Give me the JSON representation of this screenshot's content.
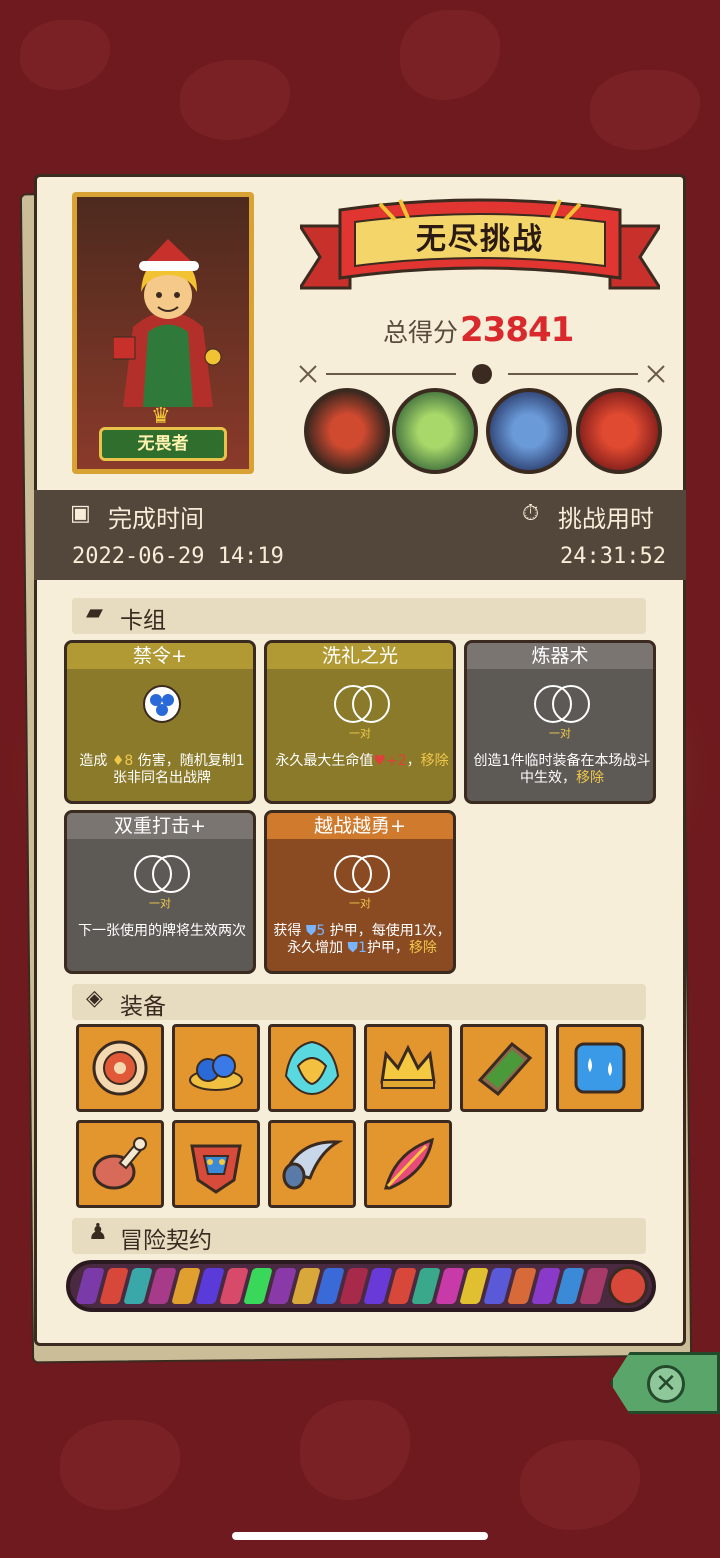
{
  "mode_title": "无尽挑战",
  "score": {
    "label": "总得分",
    "value": "23841"
  },
  "character": {
    "name": "无畏者"
  },
  "time": {
    "completed_label": "完成时间",
    "completed_value": "2022-06-29  14:19",
    "duration_label": "挑战用时",
    "duration_value": "24:31:52"
  },
  "deck": {
    "title": "卡组",
    "cards": [
      {
        "name": "禁令+",
        "pair": "",
        "desc_parts": [
          "造成 ",
          "♦8",
          " 伤害，随机复制1张非同名出战牌"
        ],
        "color": "gold"
      },
      {
        "name": "洗礼之光",
        "pair": "一对",
        "desc_parts": [
          "永久最大生命值",
          "♥+2",
          "，",
          "移除"
        ],
        "color": "gold"
      },
      {
        "name": "炼器术",
        "pair": "一对",
        "desc_parts": [
          "创造1件临时装备在本场战斗中生效，",
          "移除"
        ],
        "color": "gray"
      },
      {
        "name": "双重打击+",
        "pair": "一对",
        "desc_parts": [
          "下一张使用的牌将生效两次"
        ],
        "color": "gray"
      },
      {
        "name": "越战越勇+",
        "pair": "一对",
        "desc_parts": [
          "获得 ",
          "⛊5",
          " 护甲，每使用1次，永久增加 ",
          "⛊1",
          "护甲，",
          "移除"
        ],
        "color": "brown"
      }
    ]
  },
  "equipment": {
    "title": "装备",
    "items": [
      "shield-disc-icon",
      "blue-berries-icon",
      "flame-mask-icon",
      "crown-icon",
      "moss-tablet-icon",
      "water-cube-icon",
      "meat-leg-icon",
      "tribal-mask-icon",
      "horn-icon",
      "fire-feather-icon"
    ]
  },
  "contract": {
    "title": "冒险契约"
  },
  "colors": {
    "accent": "#d9292c",
    "paper": "#f6eed8",
    "background": "#6e1a1e"
  }
}
